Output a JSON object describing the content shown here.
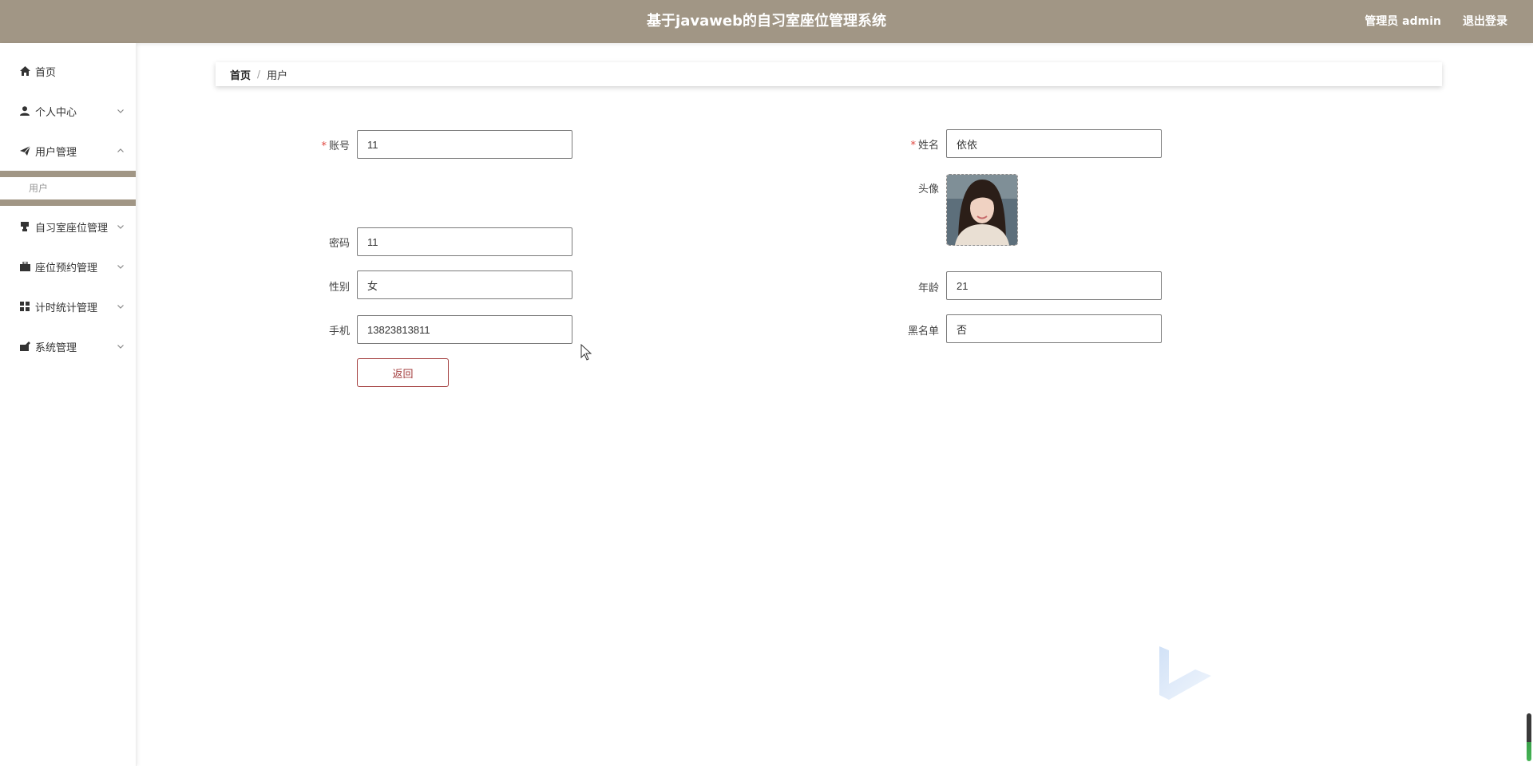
{
  "header": {
    "title": "基于javaweb的自习室座位管理系统",
    "user": "管理员 admin",
    "logout": "退出登录"
  },
  "sidebar": {
    "items": [
      {
        "label": "首页",
        "icon": "home-icon"
      },
      {
        "label": "个人中心",
        "icon": "user-icon"
      },
      {
        "label": "用户管理",
        "icon": "send-icon",
        "expanded": true,
        "children": [
          {
            "label": "用户",
            "active": true
          }
        ]
      },
      {
        "label": "自习室座位管理",
        "icon": "stamp-icon"
      },
      {
        "label": "座位预约管理",
        "icon": "briefcase-icon"
      },
      {
        "label": "计时统计管理",
        "icon": "grid-icon"
      },
      {
        "label": "系统管理",
        "icon": "tool-icon"
      }
    ]
  },
  "breadcrumb": {
    "home": "首页",
    "separator": "/",
    "current": "用户"
  },
  "form": {
    "account": {
      "label": "账号",
      "value": "11",
      "required": true
    },
    "name": {
      "label": "姓名",
      "value": "依依",
      "required": true
    },
    "avatar": {
      "label": "头像"
    },
    "password": {
      "label": "密码",
      "value": "11"
    },
    "gender": {
      "label": "性别",
      "value": "女"
    },
    "age": {
      "label": "年龄",
      "value": "21"
    },
    "phone": {
      "label": "手机",
      "value": "13823813811"
    },
    "blacklist": {
      "label": "黑名单",
      "value": "否"
    },
    "back_button": "返回"
  },
  "colors": {
    "header_bg": "#a19685",
    "accent": "#a33d3d",
    "required": "#e0463f"
  }
}
